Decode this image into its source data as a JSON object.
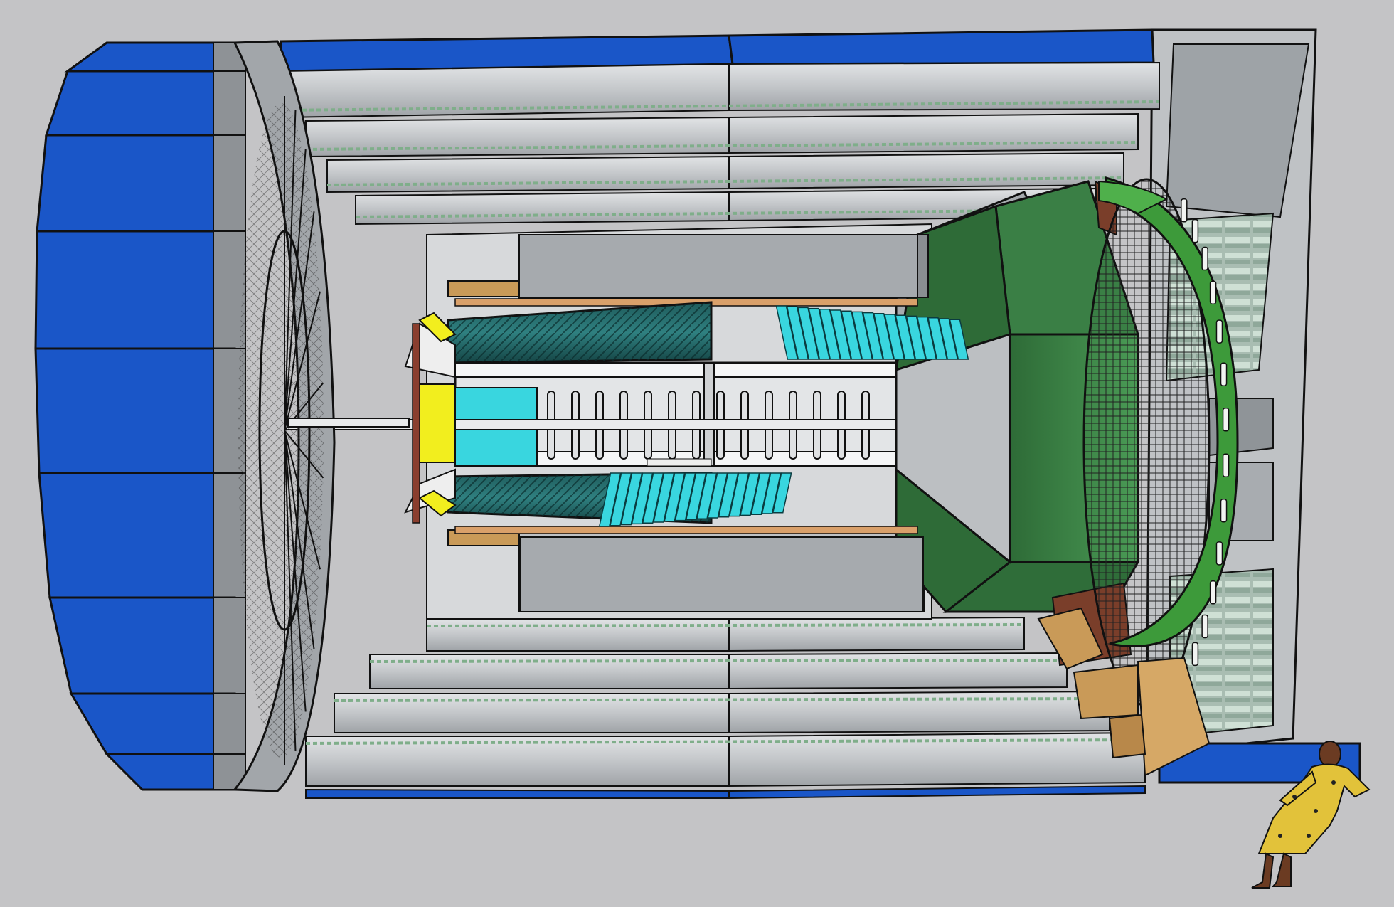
{
  "colors": {
    "background": "#c4c4c6",
    "muon_blue": "#1a56c8",
    "steel_gray": "#b9bcbf",
    "steel_light": "#d6d8da",
    "steel_dark": "#7d8185",
    "calorimeter_green": "#3f8a4a",
    "calorimeter_dark": "#2a5f34",
    "ring_green": "#3d9a3a",
    "cyan_modules": "#39d6df",
    "teal_dark": "#1f5c5c",
    "yellow": "#f2ee1e",
    "wood": "#c99a58",
    "copper": "#b86a3a",
    "outline": "#111111"
  },
  "icons": {
    "figure": "person-scale-figure-icon"
  }
}
